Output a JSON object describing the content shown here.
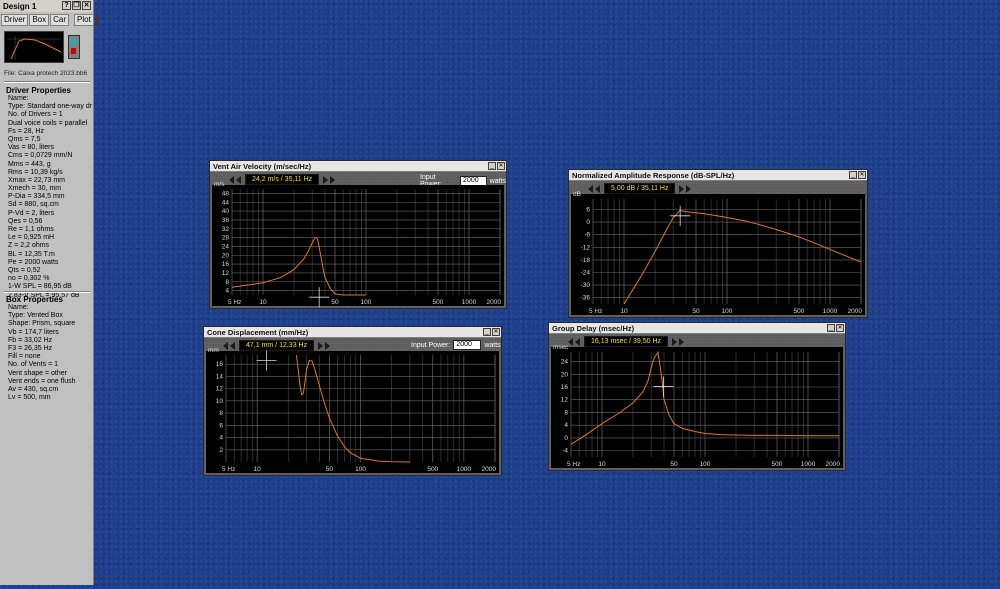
{
  "sidebar": {
    "title": "Design 1",
    "tabs": [
      "Driver",
      "Box",
      "Car",
      "Plot"
    ],
    "file": "File: Caixa protech 2023.bb6",
    "driver_header": "Driver Properties",
    "driver_lines": [
      "Name:",
      "Type: Standard one-way driver",
      "No. of Drivers = 1",
      "Dual voice coils = parallel",
      "Fs = 28, Hz",
      "Qms = 7,5",
      "Vas = 80, liters",
      "Cms = 0,0729 mm/N",
      "Mms = 443, g",
      "Rms = 10,39 kg/s",
      "Xmax = 22,73 mm",
      "Xmech = 30, mm",
      "P-Dia = 334,5 mm",
      "Sd = 880, sq.cm",
      "P-Vd = 2, liters",
      "Qes = 0,56",
      "Re = 1,1 ohms",
      "Le = 0,925 mH",
      "Z = 2,2 ohms",
      "BL = 12,35 T.m",
      "Pe = 2000 watts",
      "Qts = 0,52",
      "no = 0,302 %",
      "1-W SPL = 86,95 dB",
      "2.83-V SPL = 95,57 dB"
    ],
    "box_header": "Box Properties",
    "box_lines": [
      "Name:",
      "Type: Vented Box",
      "Shape: Prism, square",
      "Vb = 174,7 liters",
      "Fb = 33,02 Hz",
      "F3 = 26,35 Hz",
      "Fill = none",
      "No. of Vents = 1",
      "  Vent shape = other",
      "  Vent ends = one flush",
      "  Av = 430, sq.cm",
      "  Lv = 500, mm"
    ]
  },
  "colors": {
    "background": "#1e3f8c",
    "curve": "#e07a1a",
    "readout_text": "#f2e416"
  },
  "x_ticks": [
    "5 Hz",
    "10",
    "50",
    "100",
    "500",
    "1000",
    "2000"
  ],
  "windows": {
    "vent": {
      "title": "Vent Air Velocity (m/sec/Hz)",
      "readout": "24,2 m/s / 35,11 Hz",
      "power_label": "Input Power:",
      "power_value": "2000",
      "power_unit": "watts",
      "unit": "m/s",
      "y_ticks": [
        "48",
        "44",
        "40",
        "36",
        "32",
        "28",
        "24",
        "20",
        "16",
        "12",
        "8",
        "4"
      ]
    },
    "naresp": {
      "title": "Normalized Amplitude Response (dB-SPL/Hz)",
      "readout": "5,00 dB / 35,11 Hz",
      "unit": "dB",
      "y_ticks": [
        "6",
        "0",
        "-6",
        "-12",
        "-18",
        "-24",
        "-30",
        "-36"
      ]
    },
    "cone": {
      "title": "Cone Displacement (mm/Hz)",
      "readout": "47,1 mm / 12,33 Hz",
      "power_label": "Input Power:",
      "power_value": "2000",
      "power_unit": "watts",
      "unit": "mm",
      "y_ticks": [
        "16",
        "14",
        "12",
        "10",
        "8",
        "6",
        "4",
        "2"
      ]
    },
    "gdelay": {
      "title": "Group Delay (msec/Hz)",
      "readout": "16,13 msec / 39,50 Hz",
      "unit": "msec",
      "y_ticks": [
        "24",
        "20",
        "16",
        "12",
        "8",
        "4",
        "0",
        "-4"
      ]
    }
  },
  "chart_data": [
    {
      "type": "line",
      "title": "Vent Air Velocity (m/sec/Hz)",
      "xscale": "log",
      "xlim": [
        5,
        2000
      ],
      "ylim": [
        2,
        50
      ],
      "x": [
        5,
        10,
        15,
        20,
        25,
        28,
        30,
        32,
        33,
        34,
        35,
        38,
        40,
        45,
        50,
        60,
        80,
        100
      ],
      "y": [
        5.5,
        7.5,
        10,
        13.5,
        18.5,
        22.5,
        25.5,
        28,
        28,
        27,
        24,
        15,
        10,
        5,
        2.5,
        1,
        0.2,
        0
      ]
    },
    {
      "type": "line",
      "title": "Normalized Amplitude Response (dB-SPL/Hz)",
      "xscale": "log",
      "xlim": [
        5,
        2000
      ],
      "ylim": [
        -39,
        11
      ],
      "x": [
        10,
        15,
        20,
        25,
        30,
        35,
        40,
        50,
        60,
        80,
        100,
        150,
        200,
        300,
        500,
        800,
        1000,
        1500,
        2000
      ],
      "y": [
        -39,
        -25,
        -14,
        -5,
        2,
        5.5,
        5,
        4.5,
        4,
        3,
        2.2,
        0.5,
        -1,
        -3.5,
        -7,
        -11,
        -13,
        -16.5,
        -19
      ]
    },
    {
      "type": "line",
      "title": "Cone Displacement (mm/Hz)",
      "xscale": "log",
      "xlim": [
        5,
        2000
      ],
      "ylim": [
        0,
        17.5
      ],
      "x": [
        24,
        25,
        26,
        27,
        28,
        29,
        30,
        32,
        34,
        36,
        40,
        45,
        50,
        60,
        70,
        80,
        100,
        150,
        200,
        300
      ],
      "y": [
        17.5,
        15,
        12.5,
        11,
        11.2,
        13,
        15,
        16.6,
        16.5,
        15.3,
        12.5,
        9.5,
        7.2,
        4.2,
        2.5,
        1.5,
        0.6,
        0.15,
        0.05,
        0
      ]
    },
    {
      "type": "line",
      "title": "Group Delay (msec/Hz)",
      "xscale": "log",
      "xlim": [
        5,
        2000
      ],
      "ylim": [
        -6,
        27
      ],
      "x": [
        5,
        7,
        10,
        15,
        20,
        25,
        28,
        30,
        32,
        35,
        38,
        40,
        45,
        50,
        60,
        80,
        100,
        150,
        200,
        300,
        500,
        1000,
        2000
      ],
      "y": [
        -2,
        1,
        4.5,
        8,
        11,
        14.5,
        18,
        22,
        25,
        27,
        19,
        12,
        7,
        4.5,
        3,
        2,
        1.4,
        1,
        0.9,
        0.8,
        0.8,
        0.7,
        0.7
      ]
    }
  ]
}
